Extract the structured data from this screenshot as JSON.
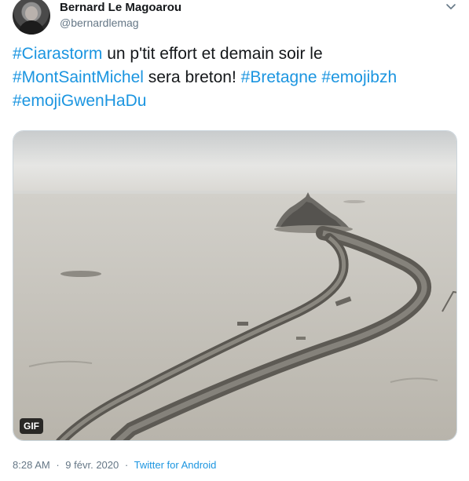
{
  "author": {
    "display_name": "Bernard Le Magoarou",
    "handle": "@bernardlemag",
    "avatar_icon": "user-avatar"
  },
  "menu": {
    "icon": "chevron-down-icon"
  },
  "tweet": {
    "segments": [
      {
        "text": "#Ciarastorm",
        "hashtag": true
      },
      {
        "text": " un p'tit effort et demain soir le ",
        "hashtag": false
      },
      {
        "text": "#MontSaintMichel",
        "hashtag": true
      },
      {
        "text": " sera breton! ",
        "hashtag": false
      },
      {
        "text": "#Bretagne",
        "hashtag": true
      },
      {
        "text": " ",
        "hashtag": false
      },
      {
        "text": "#emojibzh",
        "hashtag": true
      },
      {
        "text": " ",
        "hashtag": false
      },
      {
        "text": "#emojiGwenHaDu",
        "hashtag": true
      }
    ],
    "link_color": "#1b95e0"
  },
  "media": {
    "badge": "GIF"
  },
  "footer": {
    "time": "8:28 AM",
    "separator": "·",
    "date": "9 févr. 2020",
    "source": "Twitter for Android"
  }
}
